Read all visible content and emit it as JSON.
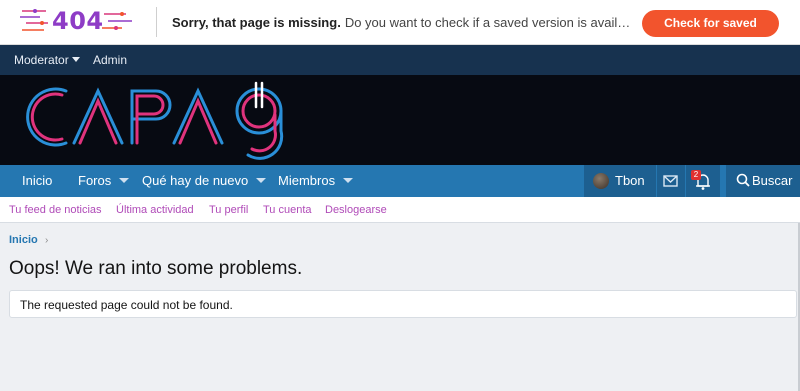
{
  "wayback": {
    "code": "404",
    "headline": "Sorry, that page is missing.",
    "message": "Do you want to check if a saved version is available on the Way...",
    "button": "Check for saved version",
    "accent": "#f2542d"
  },
  "staff_bar": {
    "items": [
      "Moderator",
      "Admin"
    ]
  },
  "nav": {
    "items": [
      "Inicio",
      "Foros",
      "Qué hay de nuevo",
      "Miembros"
    ],
    "user": "Tbon",
    "alerts_count": "2",
    "search": "Buscar",
    "icons": [
      "envelope-icon",
      "bell-icon",
      "search-icon"
    ]
  },
  "subnav": {
    "items": [
      "Tu feed de noticias",
      "Última actividad",
      "Tu perfil",
      "Tu cuenta",
      "Deslogearse"
    ]
  },
  "main": {
    "breadcrumb": "Inicio",
    "title": "Oops! We ran into some problems.",
    "notice": "The requested page could not be found."
  },
  "colors": {
    "nav": "#2577b1",
    "staff": "#17324f",
    "header": "#070a12",
    "sublink": "#b04bb8"
  }
}
